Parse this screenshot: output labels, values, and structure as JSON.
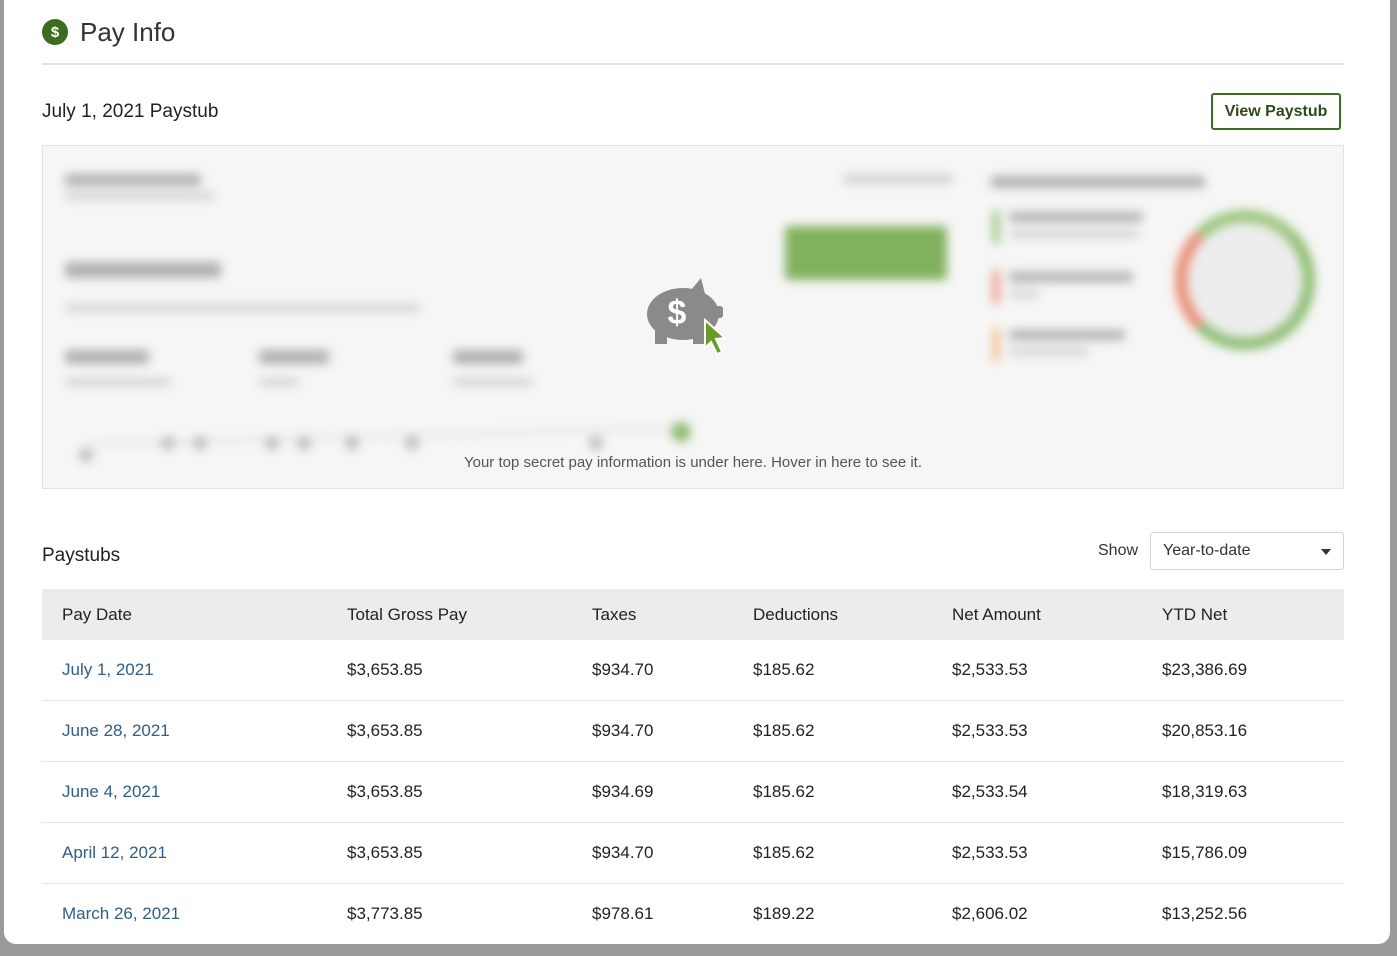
{
  "header": {
    "title": "Pay Info",
    "icon": "dollar-circle-icon",
    "icon_glyph": "$"
  },
  "paystub": {
    "title": "July 1, 2021 Paystub",
    "view_button": "View Paystub",
    "secret_message": "Your top secret pay information is under here. Hover in here to see it.",
    "overlay_icon": "piggy-bank-icon"
  },
  "paystubs": {
    "title": "Paystubs",
    "show_label": "Show",
    "filter": {
      "selected": "Year-to-date"
    },
    "columns": [
      "Pay Date",
      "Total Gross Pay",
      "Taxes",
      "Deductions",
      "Net Amount",
      "YTD Net"
    ],
    "rows": [
      [
        "July 1, 2021",
        "$3,653.85",
        "$934.70",
        "$185.62",
        "$2,533.53",
        "$23,386.69"
      ],
      [
        "June 28, 2021",
        "$3,653.85",
        "$934.70",
        "$185.62",
        "$2,533.53",
        "$20,853.16"
      ],
      [
        "June 4, 2021",
        "$3,653.85",
        "$934.69",
        "$185.62",
        "$2,533.54",
        "$18,319.63"
      ],
      [
        "April 12, 2021",
        "$3,653.85",
        "$934.70",
        "$185.62",
        "$2,533.53",
        "$15,786.09"
      ],
      [
        "March 26, 2021",
        "$3,773.85",
        "$978.61",
        "$189.22",
        "$2,606.02",
        "$13,252.56"
      ]
    ]
  },
  "colors": {
    "brand_green": "#3d6b1f",
    "link_blue": "#2f5e86"
  }
}
